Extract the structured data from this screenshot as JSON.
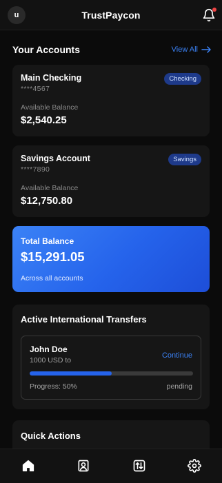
{
  "header": {
    "avatar_initial": "u",
    "title": "TrustPaycon",
    "notification_icon": "bell-icon",
    "notification_dot_color": "#ef4444"
  },
  "accounts_section": {
    "title": "Your Accounts",
    "view_all_label": "View All",
    "view_all_icon": "arrow-right-icon"
  },
  "accounts": [
    {
      "name": "Main Checking",
      "number": "****4567",
      "badge": "Checking",
      "balance_label": "Available Balance",
      "balance": "$2,540.25"
    },
    {
      "name": "Savings Account",
      "number": "****7890",
      "badge": "Savings",
      "balance_label": "Available Balance",
      "balance": "$12,750.80"
    }
  ],
  "total": {
    "label": "Total Balance",
    "amount": "$15,291.05",
    "subtitle": "Across all accounts"
  },
  "transfers": {
    "title": "Active International Transfers",
    "items": [
      {
        "name": "John Doe",
        "amount": "1000 USD to",
        "action": "Continue",
        "progress_label": "Progress: 50%",
        "progress": 0.5,
        "status": "pending"
      }
    ]
  },
  "quick_actions": {
    "title": "Quick Actions"
  },
  "bottom_nav": {
    "items": [
      {
        "icon": "home-icon",
        "active": true
      },
      {
        "icon": "user-card-icon",
        "active": false
      },
      {
        "icon": "transfer-icon",
        "active": false
      },
      {
        "icon": "settings-gear-icon",
        "active": false
      }
    ]
  },
  "colors": {
    "accent": "#3b82f6",
    "background": "#0b0b0b",
    "card": "#161616",
    "badge_bg": "#1e3a8a"
  }
}
